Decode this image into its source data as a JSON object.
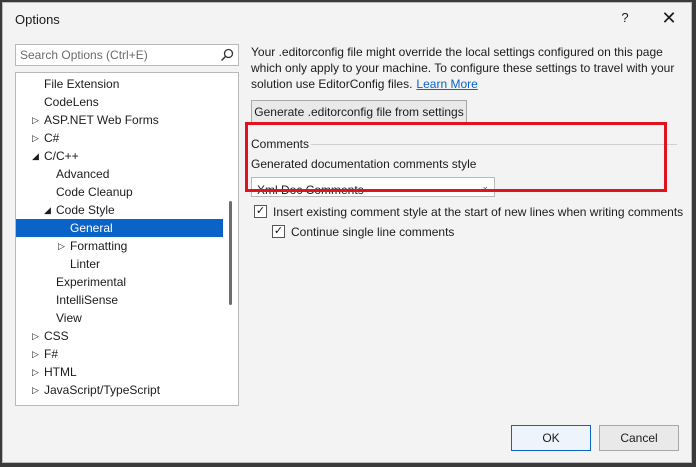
{
  "window": {
    "title": "Options",
    "help_label": "?",
    "close_label": "✕"
  },
  "search": {
    "placeholder": "Search Options (Ctrl+E)",
    "icon": "search-icon"
  },
  "tree": {
    "items": [
      {
        "label": "File Extension",
        "arrow": ""
      },
      {
        "label": "CodeLens",
        "arrow": ""
      },
      {
        "label": "ASP.NET Web Forms",
        "arrow": "▷"
      },
      {
        "label": "C#",
        "arrow": "▷"
      },
      {
        "label": "C/C++",
        "arrow": "◢"
      },
      {
        "label": "Advanced",
        "arrow": ""
      },
      {
        "label": "Code Cleanup",
        "arrow": ""
      },
      {
        "label": "Code Style",
        "arrow": "◢"
      },
      {
        "label": "General",
        "arrow": ""
      },
      {
        "label": "Formatting",
        "arrow": "▷"
      },
      {
        "label": "Linter",
        "arrow": ""
      },
      {
        "label": "Experimental",
        "arrow": ""
      },
      {
        "label": "IntelliSense",
        "arrow": ""
      },
      {
        "label": "View",
        "arrow": ""
      },
      {
        "label": "CSS",
        "arrow": "▷"
      },
      {
        "label": "F#",
        "arrow": "▷"
      },
      {
        "label": "HTML",
        "arrow": "▷"
      },
      {
        "label": "JavaScript/TypeScript",
        "arrow": "▷"
      }
    ],
    "selected": "General"
  },
  "info": {
    "text": "Your .editorconfig file might override the local settings configured on this page which only apply to your machine. To configure these settings to travel with your solution use EditorConfig files.",
    "link": "Learn More"
  },
  "generate_button": "Generate .editorconfig file from settings",
  "comments": {
    "group_label": "Comments",
    "style_label": "Generated documentation comments style",
    "combo_value": "Xml Doc Comments",
    "combo_arrow": "⌄"
  },
  "checkboxes": [
    {
      "label": "Insert existing comment style at the start of new lines when writing comments",
      "checked": true
    },
    {
      "label": "Continue single line comments",
      "checked": true
    }
  ],
  "footer": {
    "ok": "OK",
    "cancel": "Cancel"
  },
  "colors": {
    "selection": "#0a64c8",
    "highlight_box": "#e0141e",
    "link": "#0a64c8"
  }
}
